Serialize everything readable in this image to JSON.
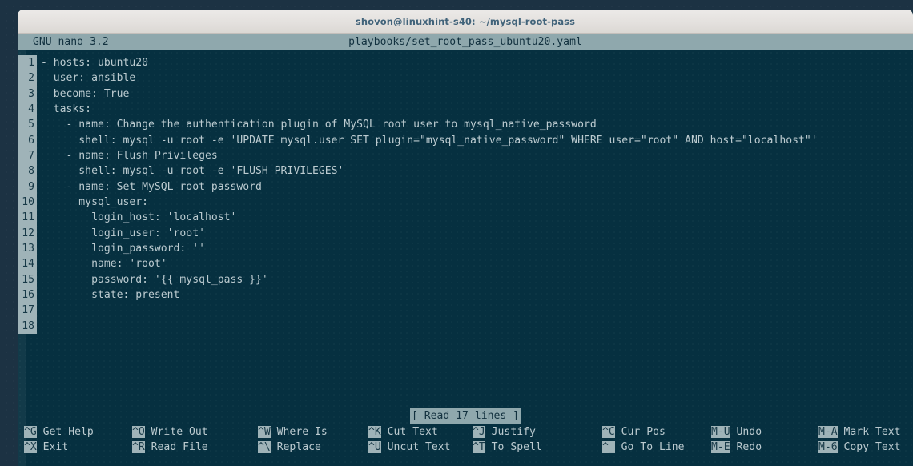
{
  "window": {
    "title": "shovon@linuxhint-s40: ~/mysql-root-pass"
  },
  "nano": {
    "version_label": "GNU nano 3.2",
    "filename": "playbooks/set_root_pass_ubuntu20.yaml",
    "status_message": "[ Read 17 lines ]"
  },
  "editor": {
    "lines": [
      {
        "num": "1",
        "text": "- hosts: ubuntu20"
      },
      {
        "num": "2",
        "text": "  user: ansible"
      },
      {
        "num": "3",
        "text": "  become: True"
      },
      {
        "num": "4",
        "text": "  tasks:"
      },
      {
        "num": "5",
        "text": "    - name: Change the authentication plugin of MySQL root user to mysql_native_password"
      },
      {
        "num": "6",
        "text": "      shell: mysql -u root -e 'UPDATE mysql.user SET plugin=\"mysql_native_password\" WHERE user=\"root\" AND host=\"localhost\"'"
      },
      {
        "num": "7",
        "text": "    - name: Flush Privileges"
      },
      {
        "num": "8",
        "text": "      shell: mysql -u root -e 'FLUSH PRIVILEGES'"
      },
      {
        "num": "9",
        "text": "    - name: Set MySQL root password"
      },
      {
        "num": "10",
        "text": "      mysql_user:"
      },
      {
        "num": "11",
        "text": "        login_host: 'localhost'"
      },
      {
        "num": "12",
        "text": "        login_user: 'root'"
      },
      {
        "num": "13",
        "text": "        login_password: ''"
      },
      {
        "num": "14",
        "text": "        name: 'root'"
      },
      {
        "num": "15",
        "text": "        password: '{{ mysql_pass }}'"
      },
      {
        "num": "16",
        "text": "        state: present"
      },
      {
        "num": "17",
        "text": ""
      },
      {
        "num": "18",
        "text": ""
      }
    ]
  },
  "shortcuts": {
    "row1": [
      {
        "key": "^G",
        "label": "Get Help"
      },
      {
        "key": "^O",
        "label": "Write Out"
      },
      {
        "key": "^W",
        "label": "Where Is"
      },
      {
        "key": "^K",
        "label": "Cut Text"
      },
      {
        "key": "^J",
        "label": "Justify"
      },
      {
        "key": "^C",
        "label": "Cur Pos"
      },
      {
        "key": "M-U",
        "label": "Undo"
      },
      {
        "key": "M-A",
        "label": "Mark Text"
      }
    ],
    "row2": [
      {
        "key": "^X",
        "label": "Exit"
      },
      {
        "key": "^R",
        "label": "Read File"
      },
      {
        "key": "^\\",
        "label": "Replace"
      },
      {
        "key": "^U",
        "label": "Uncut Text"
      },
      {
        "key": "^T",
        "label": "To Spell"
      },
      {
        "key": "^_",
        "label": "Go To Line"
      },
      {
        "key": "M-E",
        "label": "Redo"
      },
      {
        "key": "M-6",
        "label": "Copy Text"
      }
    ]
  },
  "colors": {
    "terminal_bg": "#063040",
    "desktop_bg": "#1c3243",
    "inverse_bg": "#9fb3b8",
    "inverse_fg": "#173947",
    "text_fg": "#bccbd0",
    "titlebar_bg": "#e6e3e0",
    "titlebar_fg": "#41637a"
  }
}
